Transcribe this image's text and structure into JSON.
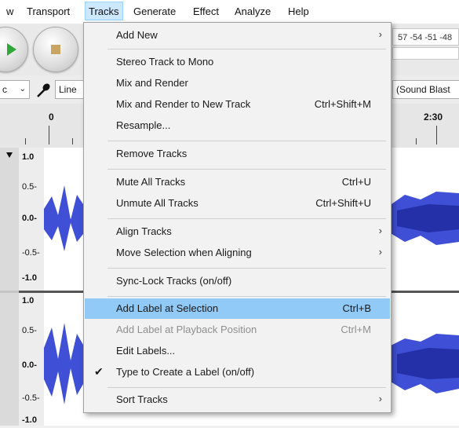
{
  "menubar": {
    "items": [
      "w",
      "Transport",
      "Tracks",
      "Generate",
      "Effect",
      "Analyze",
      "Help"
    ]
  },
  "toolbar": {
    "meter_scale": "57 -54 -51 -48"
  },
  "device": {
    "host_suffix": "c",
    "input_label": "Line",
    "output_label": "(Sound Blast"
  },
  "ruler": {
    "start_label": "0",
    "end_label": "2:30"
  },
  "tracks": [
    {
      "scale": [
        "1.0",
        "0.5-",
        "0.0-",
        "-0.5-",
        "-1.0"
      ]
    },
    {
      "scale": [
        "1.0",
        "0.5-",
        "0.0-",
        "-0.5-",
        "-1.0"
      ]
    }
  ],
  "menu": {
    "items": [
      {
        "label": "Add New",
        "shortcut": "",
        "submenu": true
      },
      {
        "label": "Stereo Track to Mono",
        "shortcut": ""
      },
      {
        "label": "Mix and Render",
        "shortcut": ""
      },
      {
        "label": "Mix and Render to New Track",
        "shortcut": "Ctrl+Shift+M"
      },
      {
        "label": "Resample...",
        "shortcut": ""
      },
      {
        "label": "Remove Tracks",
        "shortcut": ""
      },
      {
        "label": "Mute All Tracks",
        "shortcut": "Ctrl+U"
      },
      {
        "label": "Unmute All Tracks",
        "shortcut": "Ctrl+Shift+U"
      },
      {
        "label": "Align Tracks",
        "shortcut": "",
        "submenu": true
      },
      {
        "label": "Move Selection when Aligning",
        "shortcut": "",
        "submenu": true
      },
      {
        "label": "Sync-Lock Tracks (on/off)",
        "shortcut": ""
      },
      {
        "label": "Add Label at Selection",
        "shortcut": "Ctrl+B",
        "highlighted": true
      },
      {
        "label": "Add Label at Playback Position",
        "shortcut": "Ctrl+M",
        "disabled": true
      },
      {
        "label": "Edit Labels...",
        "shortcut": ""
      },
      {
        "label": "Type to Create a Label (on/off)",
        "shortcut": "",
        "checked": true
      },
      {
        "label": "Sort Tracks",
        "shortcut": "",
        "submenu": true
      }
    ]
  },
  "colors": {
    "waveform": "#3f4fd6",
    "waveform_dark": "#2430a8",
    "highlight": "#91c9f7"
  }
}
